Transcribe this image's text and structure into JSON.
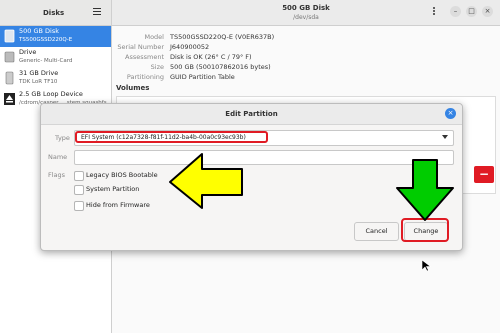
{
  "sidebar": {
    "title": "Disks",
    "devices": [
      {
        "name": "500 GB Disk",
        "sub": "TS500GSSD220Q-E",
        "selected": true
      },
      {
        "name": "Drive",
        "sub": "Generic- Multi-Card",
        "selected": false
      },
      {
        "name": "31 GB Drive",
        "sub": "TDK LoR TF10",
        "selected": false
      },
      {
        "name": "2.5 GB Loop Device",
        "sub": "/cdrom/casper.... stem.squashfs",
        "selected": false
      }
    ]
  },
  "header": {
    "title": "500 GB Disk",
    "subtitle": "/dev/sda"
  },
  "details": [
    {
      "key": "Model",
      "value": "TS500GSSD220Q-E (V0ER637B)"
    },
    {
      "key": "Serial Number",
      "value": "J640900052"
    },
    {
      "key": "Assessment",
      "value": "Disk is OK (26° C / 79° F)"
    },
    {
      "key": "Size",
      "value": "500 GB (500107862016 bytes)"
    },
    {
      "key": "Partitioning",
      "value": "GUID Partition Table"
    }
  ],
  "volumes_title": "Volumes",
  "volumes_remove_label": "−",
  "dialog": {
    "title": "Edit Partition",
    "close_label": "×",
    "type_label": "Type",
    "type_value": "EFI System (c12a7328-f81f-11d2-ba4b-00a0c93ec93b)",
    "name_label": "Name",
    "name_value": "",
    "flags_label": "Flags",
    "flags": [
      {
        "label": "Legacy BIOS Bootable",
        "checked": false
      },
      {
        "label": "System Partition",
        "checked": false
      },
      {
        "label": "Hide from Firmware",
        "checked": false
      }
    ],
    "cancel_label": "Cancel",
    "change_label": "Change"
  },
  "colors": {
    "accent": "#3584e4",
    "highlight": "#e01b24",
    "yellow_arrow": "#ffff00",
    "green_arrow": "#00cc00"
  },
  "icons": [
    "hamburger-menu-icon",
    "kebab-menu-icon",
    "minimize-icon",
    "maximize-icon",
    "close-icon",
    "dropdown-arrow-icon"
  ]
}
